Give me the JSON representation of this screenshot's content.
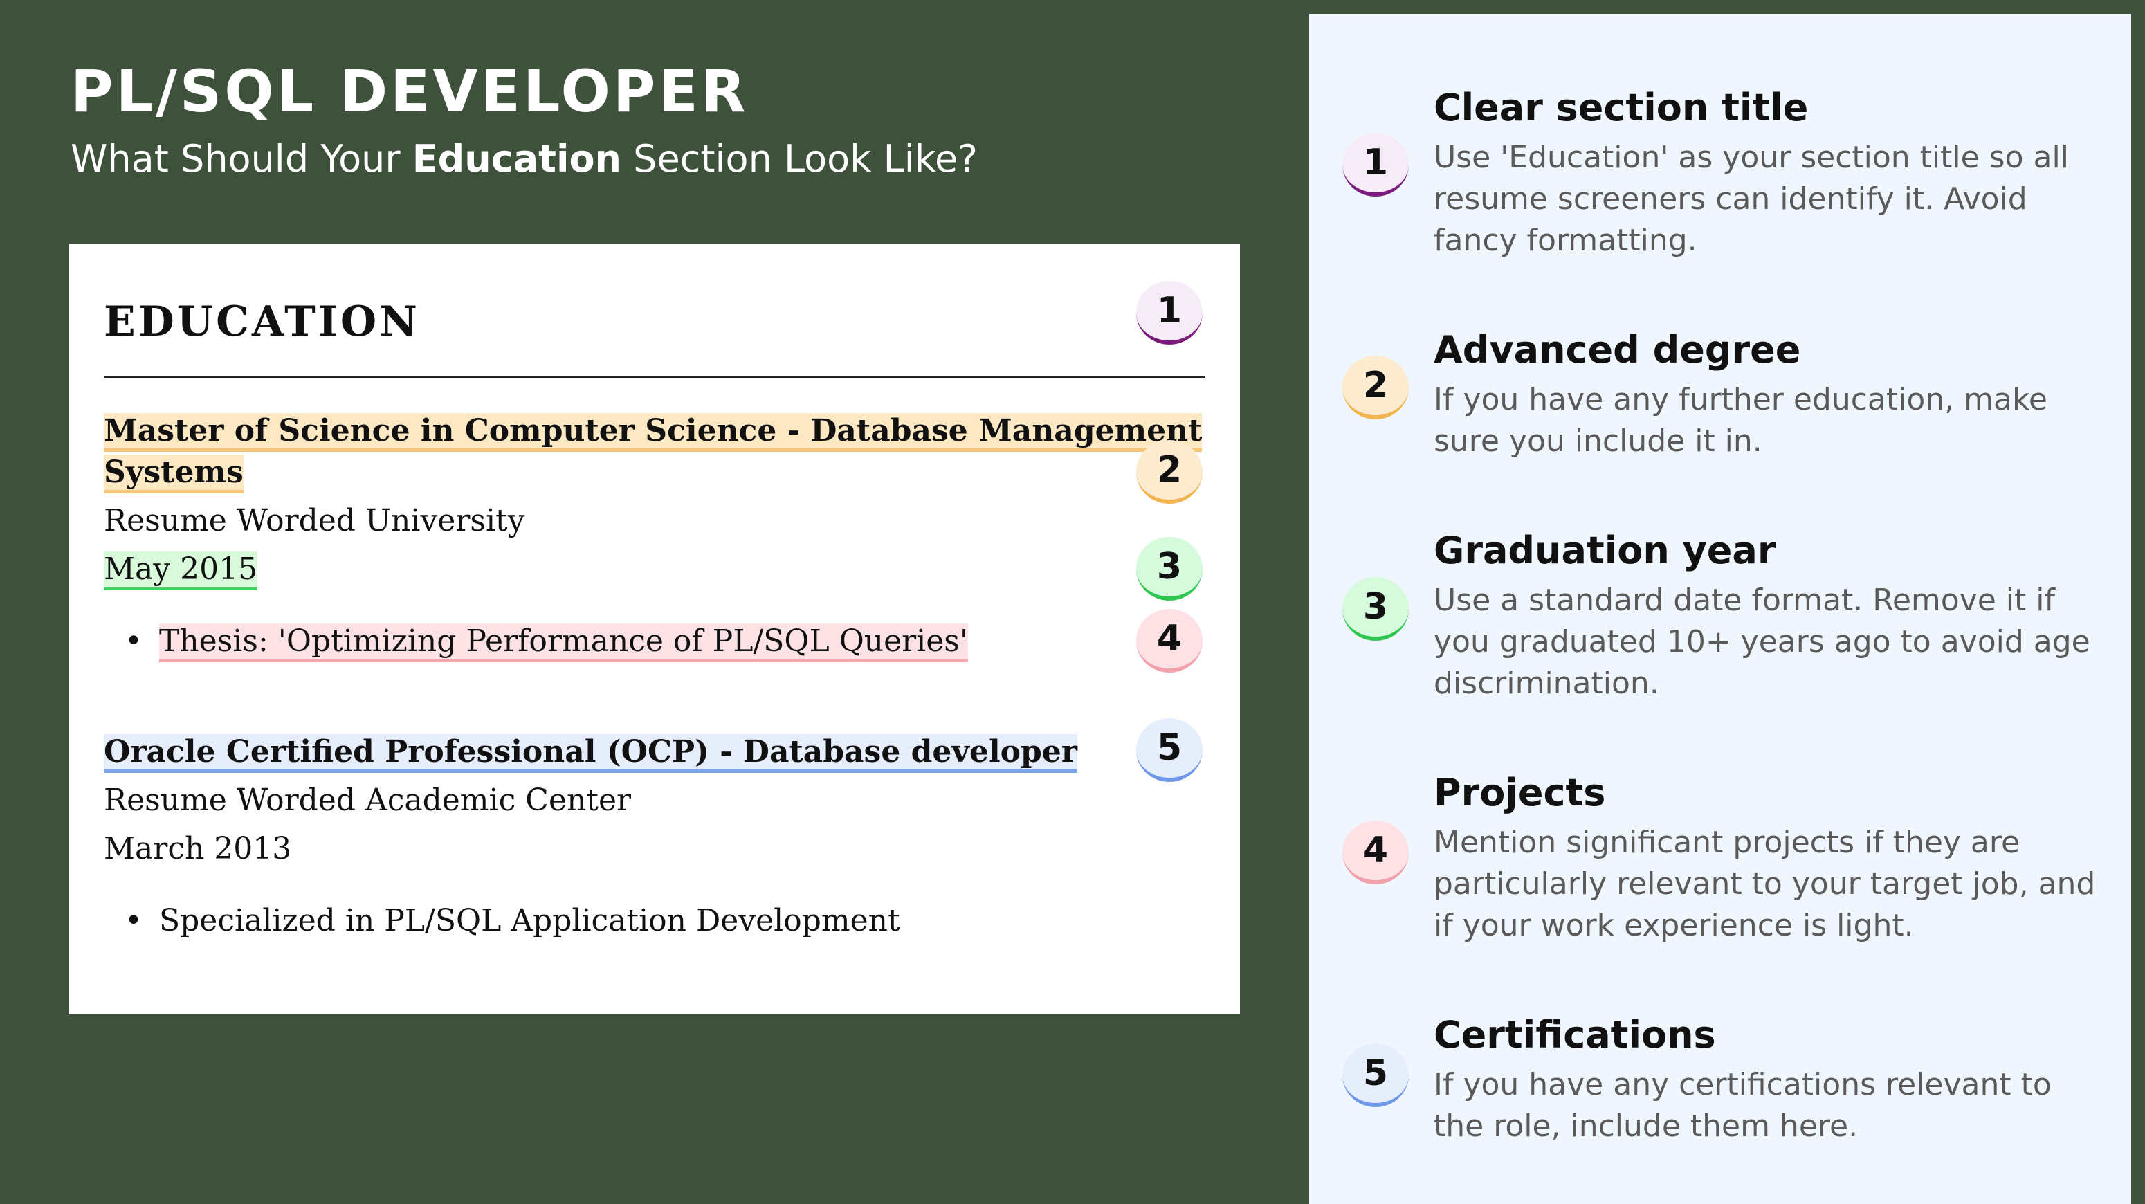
{
  "header": {
    "title": "PL/SQL DEVELOPER",
    "subtitle_pre": "What Should Your ",
    "subtitle_bold": "Education",
    "subtitle_post": " Section Look Like?"
  },
  "resume": {
    "section_title": "EDUCATION",
    "entries": [
      {
        "degree_line1": "Master of Science in Computer Science - Database Management",
        "degree_line2": "Systems",
        "school": "Resume Worded University",
        "date": "May 2015",
        "bullet": "Thesis: 'Optimizing Performance of PL/SQL Queries'"
      },
      {
        "degree_line1": "Oracle Certified Professional (OCP) - Database developer",
        "school": "Resume Worded Academic Center",
        "date": "March 2013",
        "bullet": "Specialized in PL/SQL Application Development"
      }
    ],
    "markers": [
      "1",
      "2",
      "3",
      "4",
      "5"
    ],
    "bullet_glyph": "•"
  },
  "tips": [
    {
      "number": "1",
      "title": "Clear section title",
      "text": "Use 'Education' as your section title so all resume screeners can identify it. Avoid fancy formatting."
    },
    {
      "number": "2",
      "title": "Advanced degree",
      "text": "If you have any further education, make sure you include it in."
    },
    {
      "number": "3",
      "title": "Graduation year",
      "text": "Use a standard date format. Remove it if you graduated 10+ years ago to avoid age discrimination."
    },
    {
      "number": "4",
      "title": "Projects",
      "text": "Mention significant projects if they are particularly relevant to your target job, and if your work experience is light."
    },
    {
      "number": "5",
      "title": "Certifications",
      "text": "If you have any certifications relevant to the role, include them here."
    }
  ],
  "colors": {
    "background": "#3e523b",
    "panel": "#eff6fe",
    "marker1": "#7a1a7a",
    "marker2": "#f2b44f",
    "marker3": "#2fc64f",
    "marker4": "#f2a0aa",
    "marker5": "#6f98e8"
  }
}
